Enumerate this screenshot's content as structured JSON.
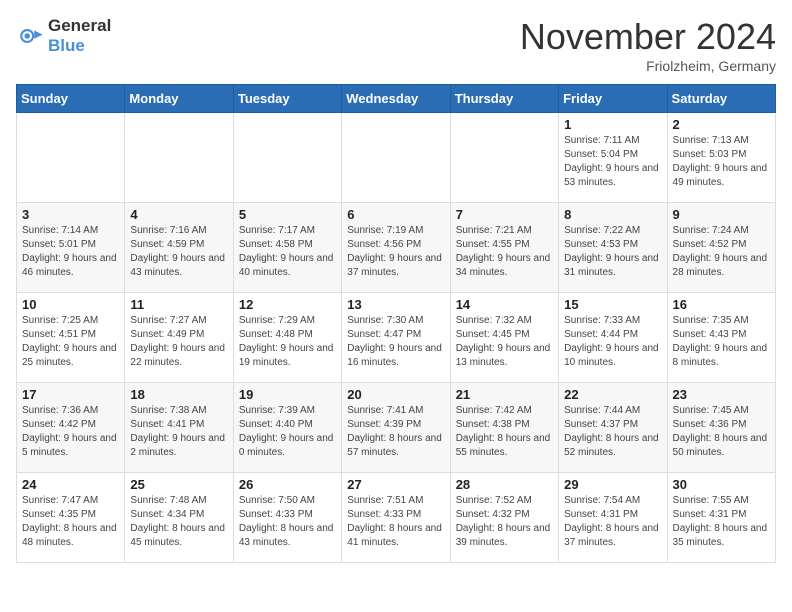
{
  "logo": {
    "text_general": "General",
    "text_blue": "Blue"
  },
  "header": {
    "month_title": "November 2024",
    "location": "Friolzheim, Germany"
  },
  "weekdays": [
    "Sunday",
    "Monday",
    "Tuesday",
    "Wednesday",
    "Thursday",
    "Friday",
    "Saturday"
  ],
  "weeks": [
    [
      {
        "day": "",
        "info": ""
      },
      {
        "day": "",
        "info": ""
      },
      {
        "day": "",
        "info": ""
      },
      {
        "day": "",
        "info": ""
      },
      {
        "day": "",
        "info": ""
      },
      {
        "day": "1",
        "info": "Sunrise: 7:11 AM\nSunset: 5:04 PM\nDaylight: 9 hours and 53 minutes."
      },
      {
        "day": "2",
        "info": "Sunrise: 7:13 AM\nSunset: 5:03 PM\nDaylight: 9 hours and 49 minutes."
      }
    ],
    [
      {
        "day": "3",
        "info": "Sunrise: 7:14 AM\nSunset: 5:01 PM\nDaylight: 9 hours and 46 minutes."
      },
      {
        "day": "4",
        "info": "Sunrise: 7:16 AM\nSunset: 4:59 PM\nDaylight: 9 hours and 43 minutes."
      },
      {
        "day": "5",
        "info": "Sunrise: 7:17 AM\nSunset: 4:58 PM\nDaylight: 9 hours and 40 minutes."
      },
      {
        "day": "6",
        "info": "Sunrise: 7:19 AM\nSunset: 4:56 PM\nDaylight: 9 hours and 37 minutes."
      },
      {
        "day": "7",
        "info": "Sunrise: 7:21 AM\nSunset: 4:55 PM\nDaylight: 9 hours and 34 minutes."
      },
      {
        "day": "8",
        "info": "Sunrise: 7:22 AM\nSunset: 4:53 PM\nDaylight: 9 hours and 31 minutes."
      },
      {
        "day": "9",
        "info": "Sunrise: 7:24 AM\nSunset: 4:52 PM\nDaylight: 9 hours and 28 minutes."
      }
    ],
    [
      {
        "day": "10",
        "info": "Sunrise: 7:25 AM\nSunset: 4:51 PM\nDaylight: 9 hours and 25 minutes."
      },
      {
        "day": "11",
        "info": "Sunrise: 7:27 AM\nSunset: 4:49 PM\nDaylight: 9 hours and 22 minutes."
      },
      {
        "day": "12",
        "info": "Sunrise: 7:29 AM\nSunset: 4:48 PM\nDaylight: 9 hours and 19 minutes."
      },
      {
        "day": "13",
        "info": "Sunrise: 7:30 AM\nSunset: 4:47 PM\nDaylight: 9 hours and 16 minutes."
      },
      {
        "day": "14",
        "info": "Sunrise: 7:32 AM\nSunset: 4:45 PM\nDaylight: 9 hours and 13 minutes."
      },
      {
        "day": "15",
        "info": "Sunrise: 7:33 AM\nSunset: 4:44 PM\nDaylight: 9 hours and 10 minutes."
      },
      {
        "day": "16",
        "info": "Sunrise: 7:35 AM\nSunset: 4:43 PM\nDaylight: 9 hours and 8 minutes."
      }
    ],
    [
      {
        "day": "17",
        "info": "Sunrise: 7:36 AM\nSunset: 4:42 PM\nDaylight: 9 hours and 5 minutes."
      },
      {
        "day": "18",
        "info": "Sunrise: 7:38 AM\nSunset: 4:41 PM\nDaylight: 9 hours and 2 minutes."
      },
      {
        "day": "19",
        "info": "Sunrise: 7:39 AM\nSunset: 4:40 PM\nDaylight: 9 hours and 0 minutes."
      },
      {
        "day": "20",
        "info": "Sunrise: 7:41 AM\nSunset: 4:39 PM\nDaylight: 8 hours and 57 minutes."
      },
      {
        "day": "21",
        "info": "Sunrise: 7:42 AM\nSunset: 4:38 PM\nDaylight: 8 hours and 55 minutes."
      },
      {
        "day": "22",
        "info": "Sunrise: 7:44 AM\nSunset: 4:37 PM\nDaylight: 8 hours and 52 minutes."
      },
      {
        "day": "23",
        "info": "Sunrise: 7:45 AM\nSunset: 4:36 PM\nDaylight: 8 hours and 50 minutes."
      }
    ],
    [
      {
        "day": "24",
        "info": "Sunrise: 7:47 AM\nSunset: 4:35 PM\nDaylight: 8 hours and 48 minutes."
      },
      {
        "day": "25",
        "info": "Sunrise: 7:48 AM\nSunset: 4:34 PM\nDaylight: 8 hours and 45 minutes."
      },
      {
        "day": "26",
        "info": "Sunrise: 7:50 AM\nSunset: 4:33 PM\nDaylight: 8 hours and 43 minutes."
      },
      {
        "day": "27",
        "info": "Sunrise: 7:51 AM\nSunset: 4:33 PM\nDaylight: 8 hours and 41 minutes."
      },
      {
        "day": "28",
        "info": "Sunrise: 7:52 AM\nSunset: 4:32 PM\nDaylight: 8 hours and 39 minutes."
      },
      {
        "day": "29",
        "info": "Sunrise: 7:54 AM\nSunset: 4:31 PM\nDaylight: 8 hours and 37 minutes."
      },
      {
        "day": "30",
        "info": "Sunrise: 7:55 AM\nSunset: 4:31 PM\nDaylight: 8 hours and 35 minutes."
      }
    ]
  ]
}
